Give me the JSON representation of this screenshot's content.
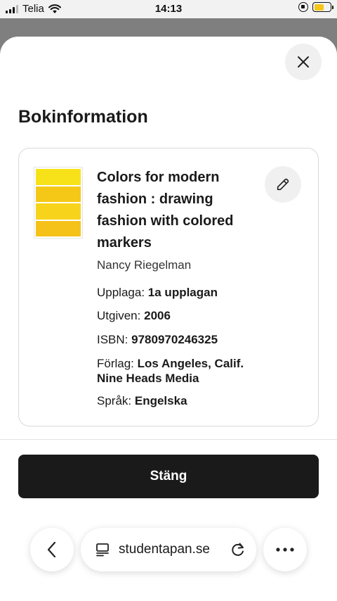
{
  "status_bar": {
    "carrier": "Telia",
    "time": "14:13",
    "battery_color": "#f5c518",
    "battery_level": 0.6
  },
  "sheet": {
    "title": "Bokinformation",
    "close_icon": "close-icon"
  },
  "book": {
    "title": "Colors for modern fashion : drawing fashion with colored markers",
    "author": "Nancy Riegelman",
    "edition_label": "Upplaga:",
    "edition_value": "1a upplagan",
    "year_label": "Utgiven:",
    "year_value": "2006",
    "isbn_label": "ISBN:",
    "isbn_value": "9780970246325",
    "publisher_label": "Förlag:",
    "publisher_value": "Los Angeles, Calif. Nine Heads Media",
    "language_label": "Språk:",
    "language_value": "Engelska",
    "edit_icon": "pencil-icon",
    "cover_colors": [
      "#f7e21a",
      "#f5c817",
      "#f7d41b",
      "#f5c21a"
    ]
  },
  "actions": {
    "close_label": "Stäng"
  },
  "browser": {
    "url": "studentapan.se",
    "back_icon": "chevron-left-icon",
    "reader_icon": "reader-icon",
    "reload_icon": "reload-icon",
    "more_icon": "more-icon"
  }
}
